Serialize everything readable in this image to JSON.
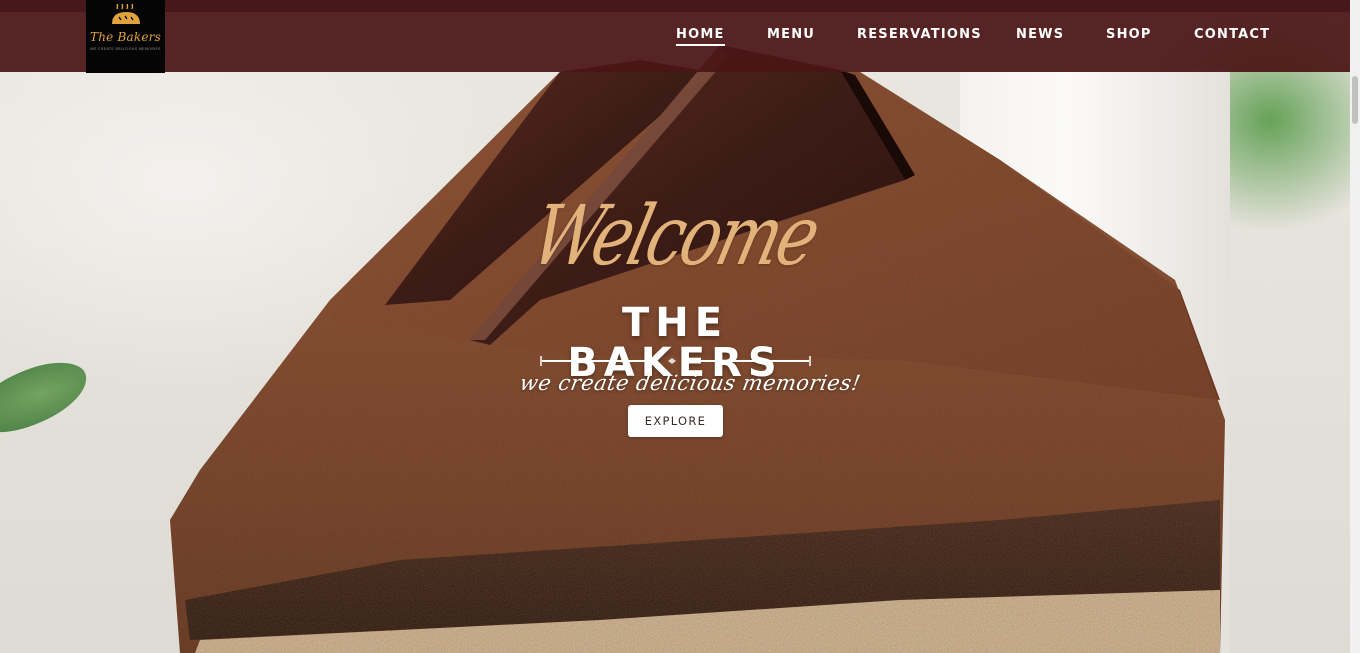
{
  "brand": {
    "logo_name": "The Bakers",
    "logo_tagline": "we create delicious memories"
  },
  "nav": {
    "items": [
      {
        "label": "HOME",
        "active": true
      },
      {
        "label": "MENU",
        "active": false
      },
      {
        "label": "RESERVATIONS",
        "active": false
      },
      {
        "label": "NEWS",
        "active": false
      },
      {
        "label": "SHOP",
        "active": false
      },
      {
        "label": "CONTACT",
        "active": false
      }
    ]
  },
  "hero": {
    "welcome": "Welcome",
    "title": "THE BAKERS",
    "tagline": "we create delicious memories!",
    "explore_label": "EXPLORE"
  },
  "colors": {
    "header_bg": "#4a1416",
    "logo_gold": "#e0a33c",
    "welcome_gold": "#e2b27b",
    "cocoa": "#8a4a2c"
  },
  "icons": {
    "logo_mark": "bread-icon"
  }
}
